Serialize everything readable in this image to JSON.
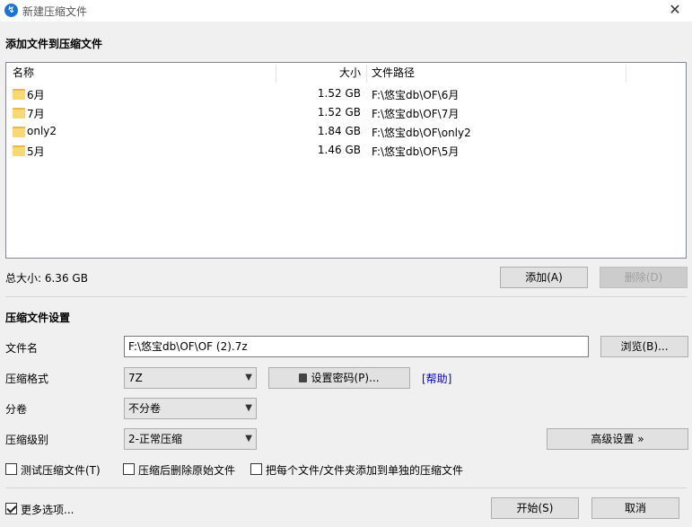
{
  "window": {
    "title": "新建压缩文件",
    "app_icon_glyph": "↯"
  },
  "add_section": {
    "title": "添加文件到压缩文件"
  },
  "file_list": {
    "columns": {
      "name": "名称",
      "size": "大小",
      "path": "文件路径"
    },
    "rows": [
      {
        "name": "6月",
        "size": "1.52 GB",
        "path": "F:\\悠宝db\\OF\\6月"
      },
      {
        "name": "7月",
        "size": "1.52 GB",
        "path": "F:\\悠宝db\\OF\\7月"
      },
      {
        "name": "only2",
        "size": "1.84 GB",
        "path": "F:\\悠宝db\\OF\\only2"
      },
      {
        "name": "5月",
        "size": "1.46 GB",
        "path": "F:\\悠宝db\\OF\\5月"
      }
    ]
  },
  "total_size": "总大小: 6.36 GB",
  "buttons": {
    "add": "添加(A)",
    "delete": "删除(D)",
    "browse": "浏览(B)...",
    "set_password": "设置密码(P)...",
    "advanced": "高级设置 »",
    "start": "开始(S)",
    "cancel": "取消"
  },
  "settings": {
    "title": "压缩文件设置",
    "filename_label": "文件名",
    "filename_value": "F:\\悠宝db\\OF\\OF (2).7z",
    "format_label": "压缩格式",
    "format_value": "7Z",
    "help_link": "[帮助]",
    "split_label": "分卷",
    "split_value": "不分卷",
    "level_label": "压缩级别",
    "level_value": "2-正常压缩"
  },
  "options": {
    "test_archive": "测试压缩文件(T)",
    "delete_after": "压缩后删除原始文件",
    "separate_archives": "把每个文件/文件夹添加到单独的压缩文件"
  },
  "more_options": {
    "label": "更多选项...",
    "checked": true
  },
  "icons": {
    "close": "close-icon",
    "folder": "folder-icon",
    "lock": "lock-icon",
    "chevron": "chevron-down-icon"
  }
}
